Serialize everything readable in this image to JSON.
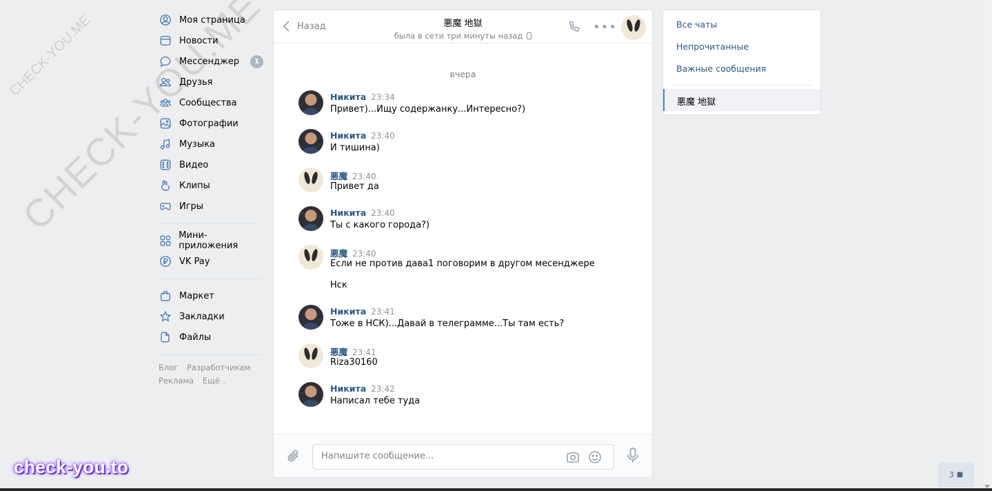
{
  "watermark": {
    "big": "CHECK-YOU.ME",
    "small": "CHECK-YOU.ME",
    "brand": "check-you.to"
  },
  "nav": {
    "items": [
      {
        "label": "Моя страница",
        "icon": "user-circle-icon"
      },
      {
        "label": "Новости",
        "icon": "news-icon"
      },
      {
        "label": "Мессенджер",
        "icon": "message-icon",
        "badge": "1"
      },
      {
        "label": "Друзья",
        "icon": "friends-icon"
      },
      {
        "label": "Сообщества",
        "icon": "communities-icon"
      },
      {
        "label": "Фотографии",
        "icon": "photos-icon"
      },
      {
        "label": "Музыка",
        "icon": "music-icon"
      },
      {
        "label": "Видео",
        "icon": "video-icon"
      },
      {
        "label": "Клипы",
        "icon": "clips-icon"
      },
      {
        "label": "Игры",
        "icon": "games-icon"
      }
    ],
    "items2": [
      {
        "label": "Мини-приложения",
        "icon": "apps-icon"
      },
      {
        "label": "VK Pay",
        "icon": "vkpay-icon"
      }
    ],
    "items3": [
      {
        "label": "Маркет",
        "icon": "market-icon"
      },
      {
        "label": "Закладки",
        "icon": "bookmarks-icon"
      },
      {
        "label": "Файлы",
        "icon": "files-icon"
      }
    ],
    "footer": {
      "blog": "Блог",
      "developers": "Разработчикам",
      "ads": "Реклама",
      "more": "Ещё"
    }
  },
  "chat": {
    "back_label": "Назад",
    "title": "悪魔 地獄",
    "status": "была в сети три минуты назад",
    "date_separator": "вчера",
    "messages": [
      {
        "author": "Никита",
        "time": "23:34",
        "text": "Привет)...Ищу содержанку...Интересно?)",
        "avatar": "nikita"
      },
      {
        "author": "Никита",
        "time": "23:40",
        "text": "И тишина)",
        "avatar": "nikita"
      },
      {
        "author": "悪魔",
        "time": "23:40",
        "text": "Привет да",
        "avatar": "demon"
      },
      {
        "author": "Никита",
        "time": "23:40",
        "text": "Ты с какого города?)",
        "avatar": "nikita"
      },
      {
        "author": "悪魔",
        "time": "23:40",
        "text": "Если не против дава1 поговорим в другом месенджере",
        "text2": "Нск",
        "avatar": "demon"
      },
      {
        "author": "Никита",
        "time": "23:41",
        "text": "Тоже в НСК)...Давай в телеграмме...Ты там есть?",
        "avatar": "nikita"
      },
      {
        "author": "悪魔",
        "time": "23:41",
        "text": "Riza30160",
        "avatar": "demon"
      },
      {
        "author": "Никита",
        "time": "23:42",
        "text": "Написал тебе туда",
        "avatar": "nikita"
      }
    ],
    "composer_placeholder": "Напишите сообщение..."
  },
  "right_panel": {
    "filters": [
      "Все чаты",
      "Непрочитанные",
      "Важные сообщения"
    ],
    "active_chat": "悪魔 地獄"
  },
  "online_count": "3",
  "colors": {
    "accent": "#5181b8",
    "link": "#2a5885",
    "background": "#edeef0"
  }
}
